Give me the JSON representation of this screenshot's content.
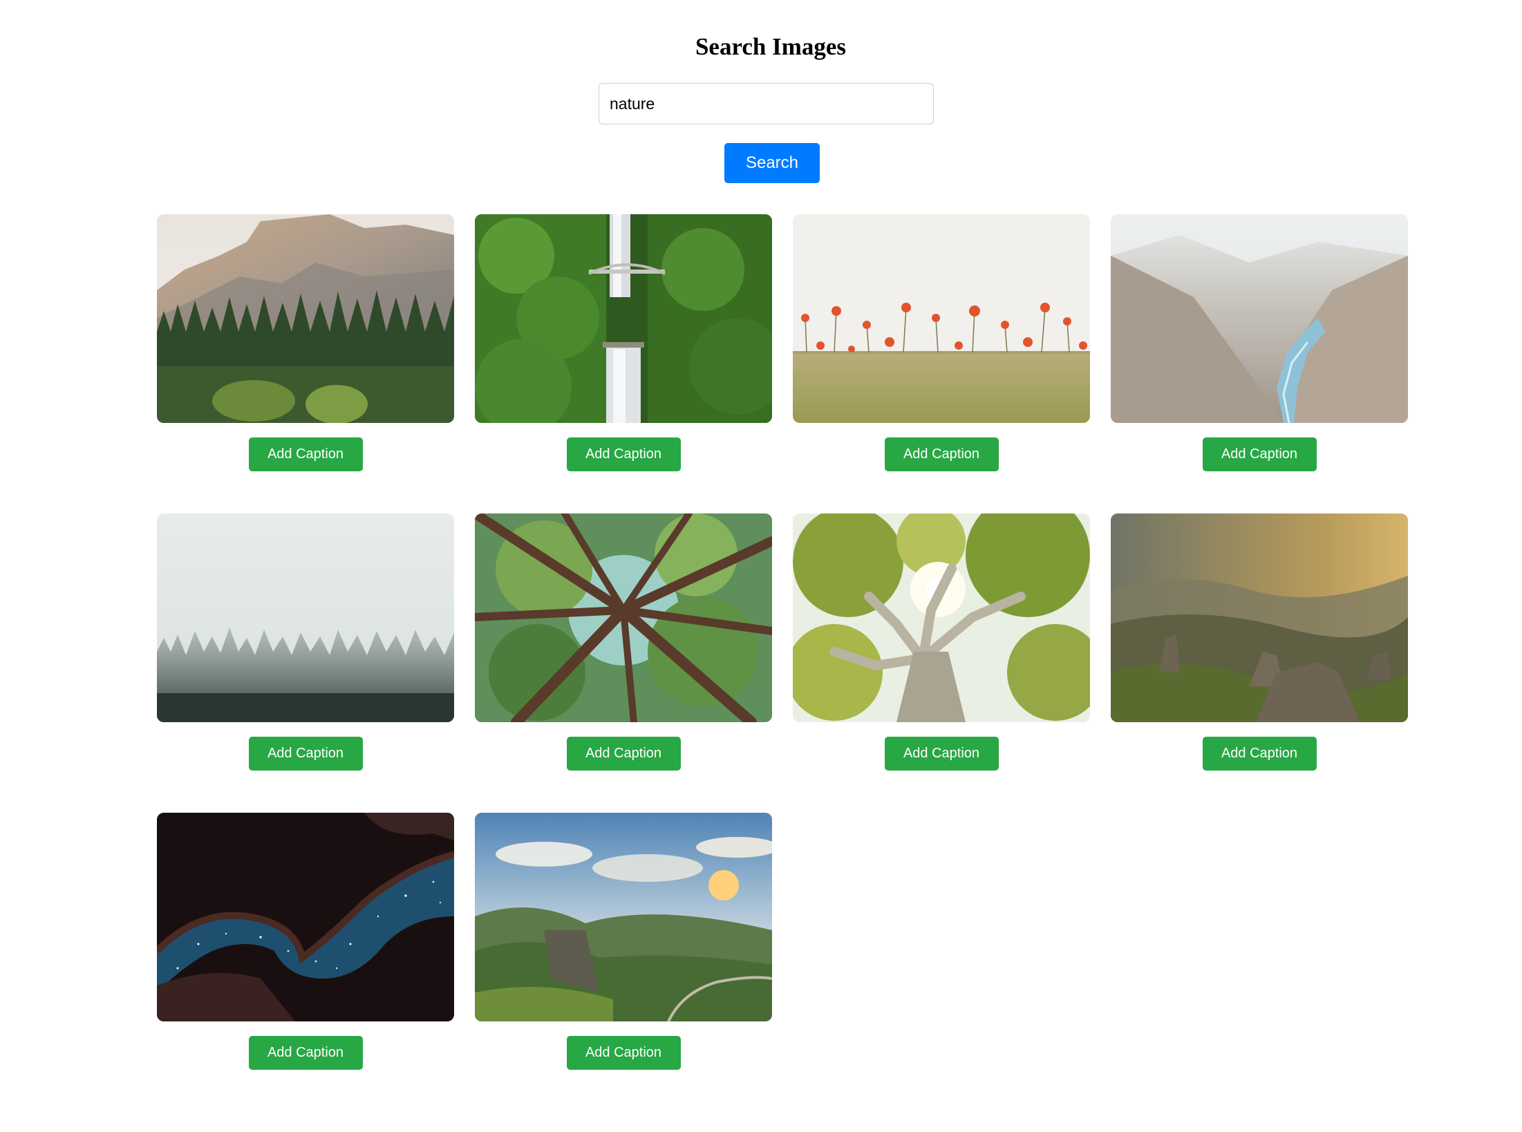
{
  "header": {
    "title": "Search Images"
  },
  "search": {
    "value": "nature",
    "button_label": "Search"
  },
  "results": [
    {
      "scene": "mountain-forest",
      "caption_button": "Add Caption"
    },
    {
      "scene": "waterfall-bridge",
      "caption_button": "Add Caption"
    },
    {
      "scene": "poppy-field",
      "caption_button": "Add Caption"
    },
    {
      "scene": "canyon-river",
      "caption_button": "Add Caption"
    },
    {
      "scene": "foggy-forest",
      "caption_button": "Add Caption"
    },
    {
      "scene": "tall-trees-canopy",
      "caption_button": "Add Caption"
    },
    {
      "scene": "sunlit-tree",
      "caption_button": "Add Caption"
    },
    {
      "scene": "misty-valley-hills",
      "caption_button": "Add Caption"
    },
    {
      "scene": "night-cave-stars",
      "caption_button": "Add Caption"
    },
    {
      "scene": "green-valley-sunset",
      "caption_button": "Add Caption"
    }
  ],
  "colors": {
    "primary": "#007bff",
    "success": "#28a745",
    "input_border": "#cfcfcf",
    "background": "#ffffff"
  }
}
